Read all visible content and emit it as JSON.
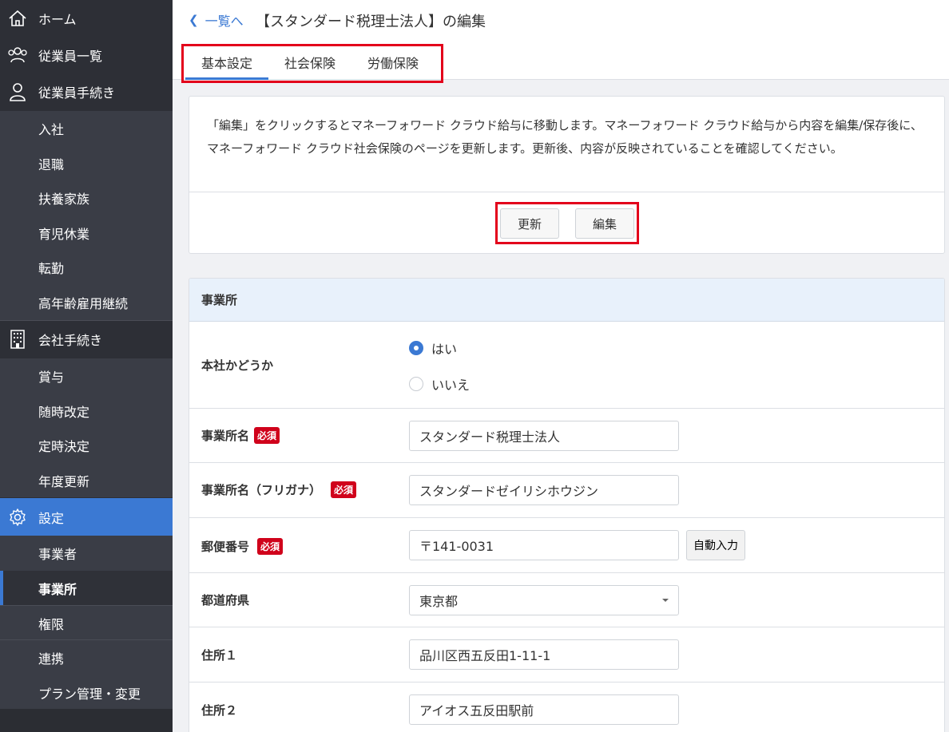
{
  "sidebar": {
    "home": "ホーム",
    "employees": "従業員一覧",
    "employee_procedures": "従業員手続き",
    "employee_sub": [
      "入社",
      "退職",
      "扶養家族",
      "育児休業",
      "転勤",
      "高年齢雇用継続"
    ],
    "company_procedures": "会社手続き",
    "company_sub": [
      "賞与",
      "随時改定",
      "定時決定",
      "年度更新"
    ],
    "settings": "設定",
    "settings_sub": [
      "事業者",
      "事業所",
      "権限",
      "連携",
      "プラン管理・変更"
    ]
  },
  "header": {
    "back_label": "一覧へ",
    "title": "【スタンダード税理士法人】の編集",
    "tabs": [
      "基本設定",
      "社会保険",
      "労働保険"
    ]
  },
  "info": {
    "text": "「編集」をクリックするとマネーフォワード クラウド給与に移動します。マネーフォワード クラウド給与から内容を編集/保存後に、マネーフォワード クラウド社会保険のページを更新します。更新後、内容が反映されていることを確認してください。",
    "refresh_button": "更新",
    "edit_button": "編集"
  },
  "form": {
    "section_title": "事業所",
    "required_badge": "必須",
    "head_office": {
      "label": "本社かどうか",
      "options": [
        "はい",
        "いいえ"
      ],
      "selected": "はい"
    },
    "office_name": {
      "label": "事業所名",
      "value": "スタンダード税理士法人"
    },
    "office_name_kana": {
      "label": "事業所名（フリガナ）",
      "value": "スタンダードゼイリシホウジン"
    },
    "postal_code": {
      "label": "郵便番号",
      "value": "〒141-0031",
      "autofill_button": "自動入力"
    },
    "prefecture": {
      "label": "都道府県",
      "value": "東京都"
    },
    "address1": {
      "label": "住所１",
      "value": "品川区西五反田1-11-1"
    },
    "address2": {
      "label": "住所２",
      "value": "アイオス五反田駅前"
    }
  },
  "colors": {
    "accent": "#3b79d3",
    "sidebar": "#2d2f36",
    "required": "#d0021b",
    "highlight": "#e3001b"
  }
}
